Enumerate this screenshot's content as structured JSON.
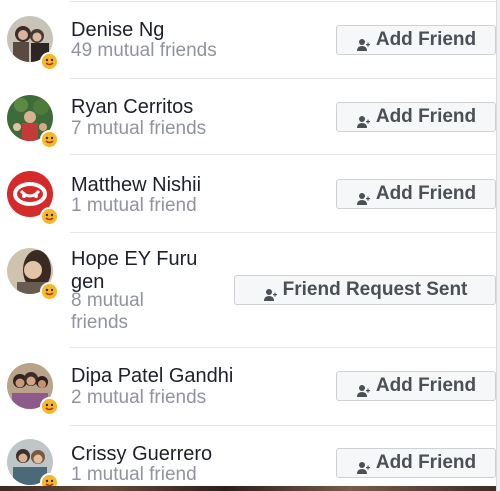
{
  "people": [
    {
      "name": "Denise Ng",
      "mutual": "49 mutual friends",
      "button": "Add Friend",
      "icon": "add-friend-icon"
    },
    {
      "name": "Ryan Cerritos",
      "mutual": "7 mutual friends",
      "button": "Add Friend",
      "icon": "add-friend-icon"
    },
    {
      "name": "Matthew Nishii",
      "mutual": "1 mutual friend",
      "button": "Add Friend",
      "icon": "add-friend-icon"
    },
    {
      "name_line1": "Hope EY Furu",
      "name_line2": "gen",
      "mutual_line1": "8 mutual",
      "mutual_line2": "friends",
      "button": "Friend Request Sent",
      "icon": "add-friend-icon"
    },
    {
      "name": "Dipa Patel Gandhi",
      "mutual": "2 mutual friends",
      "button": "Add Friend",
      "icon": "add-friend-icon"
    },
    {
      "name": "Crissy Guerrero",
      "mutual": "1 mutual friend",
      "button": "Add Friend",
      "icon": "add-friend-icon"
    }
  ],
  "colors": {
    "name_text": "#1d2129",
    "secondary_text": "#90949c",
    "button_bg": "#f6f7f9",
    "button_border": "#ced0d4",
    "button_text": "#4b4f56",
    "badge": "#f5b72b",
    "divider": "#e3e5e9"
  }
}
